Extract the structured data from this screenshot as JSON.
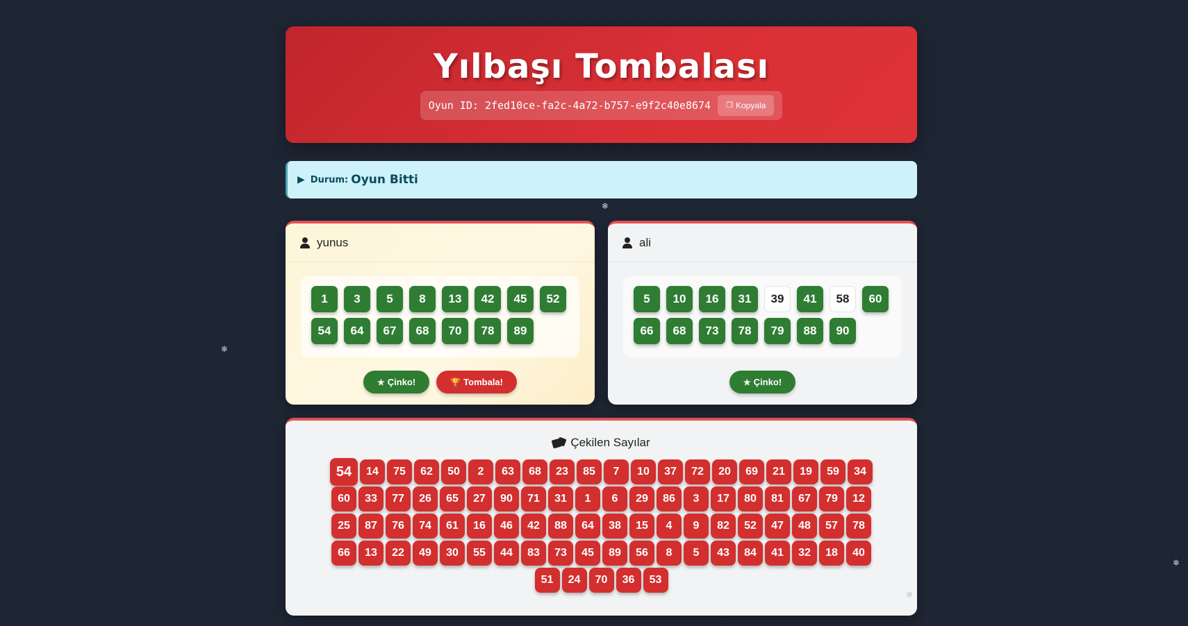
{
  "header": {
    "title": "Yılbaşı Tombalası",
    "game_id_label": "Oyun ID:",
    "game_id": "2fed10ce-fa2c-4a72-b757-e9f2c40e8674",
    "copy_label": "Kopyala"
  },
  "status": {
    "label": "Durum:",
    "value": "Oyun Bitti"
  },
  "players": [
    {
      "name": "yunus",
      "active": true,
      "numbers": [
        {
          "n": "1",
          "marked": true
        },
        {
          "n": "3",
          "marked": true
        },
        {
          "n": "5",
          "marked": true
        },
        {
          "n": "8",
          "marked": true
        },
        {
          "n": "13",
          "marked": true
        },
        {
          "n": "42",
          "marked": true
        },
        {
          "n": "45",
          "marked": true
        },
        {
          "n": "52",
          "marked": true
        },
        {
          "n": "54",
          "marked": true
        },
        {
          "n": "64",
          "marked": true
        },
        {
          "n": "67",
          "marked": true
        },
        {
          "n": "68",
          "marked": true
        },
        {
          "n": "70",
          "marked": true
        },
        {
          "n": "78",
          "marked": true
        },
        {
          "n": "89",
          "marked": true
        }
      ],
      "buttons": [
        {
          "label": "Çinko!",
          "style": "green",
          "icon": "star-icon"
        },
        {
          "label": "Tombala!",
          "style": "red",
          "icon": "trophy-icon"
        }
      ]
    },
    {
      "name": "ali",
      "active": false,
      "numbers": [
        {
          "n": "5",
          "marked": true
        },
        {
          "n": "10",
          "marked": true
        },
        {
          "n": "16",
          "marked": true
        },
        {
          "n": "31",
          "marked": true
        },
        {
          "n": "39",
          "marked": false
        },
        {
          "n": "41",
          "marked": true
        },
        {
          "n": "58",
          "marked": false
        },
        {
          "n": "60",
          "marked": true
        },
        {
          "n": "66",
          "marked": true
        },
        {
          "n": "68",
          "marked": true
        },
        {
          "n": "73",
          "marked": true
        },
        {
          "n": "78",
          "marked": true
        },
        {
          "n": "79",
          "marked": true
        },
        {
          "n": "88",
          "marked": true
        },
        {
          "n": "90",
          "marked": true
        }
      ],
      "buttons": [
        {
          "label": "Çinko!",
          "style": "green",
          "icon": "star-icon"
        }
      ]
    }
  ],
  "drawn": {
    "title": "Çekilen Sayılar",
    "numbers": [
      "54",
      "14",
      "75",
      "62",
      "50",
      "2",
      "63",
      "68",
      "23",
      "85",
      "7",
      "10",
      "37",
      "72",
      "20",
      "69",
      "21",
      "19",
      "59",
      "34",
      "60",
      "33",
      "77",
      "26",
      "65",
      "27",
      "90",
      "71",
      "31",
      "1",
      "6",
      "29",
      "86",
      "3",
      "17",
      "80",
      "81",
      "67",
      "79",
      "12",
      "25",
      "87",
      "76",
      "74",
      "61",
      "16",
      "46",
      "42",
      "88",
      "64",
      "38",
      "15",
      "4",
      "9",
      "82",
      "52",
      "47",
      "48",
      "57",
      "78",
      "66",
      "13",
      "22",
      "49",
      "30",
      "55",
      "44",
      "83",
      "73",
      "45",
      "89",
      "56",
      "8",
      "5",
      "43",
      "84",
      "41",
      "32",
      "18",
      "40",
      "51",
      "24",
      "70",
      "36",
      "53"
    ]
  },
  "colors": {
    "red": "#d32f2f",
    "green": "#2e7d32",
    "status_bg": "#cdf2fa"
  }
}
